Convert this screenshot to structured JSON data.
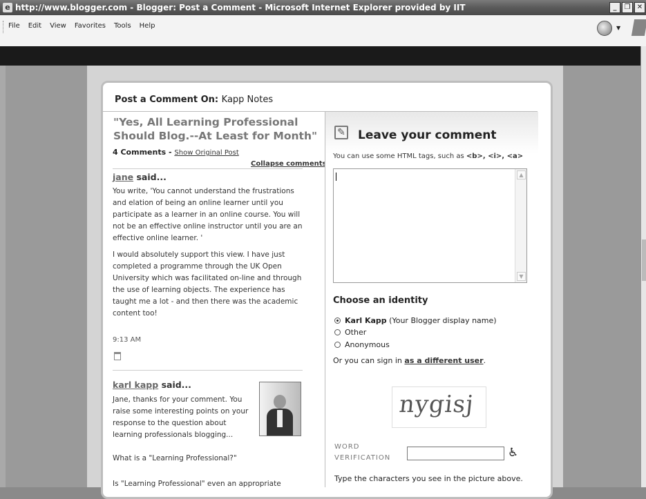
{
  "window": {
    "title": "http://www.blogger.com - Blogger: Post a Comment - Microsoft Internet Explorer provided by IIT",
    "buttons": {
      "minimize": "_",
      "restore": "❐",
      "close": "✕"
    }
  },
  "menubar": {
    "items": [
      "File",
      "Edit",
      "View",
      "Favorites",
      "Tools",
      "Help"
    ]
  },
  "page": {
    "heading_prefix": "Post a Comment On:",
    "blog_name": "Kapp Notes",
    "post_title": "\"Yes, All Learning Professional Should Blog.--At Least for Month\"",
    "comment_count": "4 Comments",
    "count_separator": "-",
    "show_original": "Show Original Post",
    "collapse": "Collapse comments",
    "comments": [
      {
        "author": "jane",
        "said": "said...",
        "text_1": "You write, 'You cannot understand the frustrations and elation of being an online learner until you participate as a learner in an online course. You will not be an effective online instructor until you are an effective online learner. '",
        "text_2": "I would absolutely support this view. I have just completed a programme through the UK Open University which was facilitated on-line and through the use of learning objects. The experience has taught me a lot - and then there was the academic content too!",
        "time": "9:13 AM"
      },
      {
        "author": "karl kapp",
        "said": "said...",
        "text_1": "Jane, thanks for your comment. You raise some interesting points on your response to the question about learning professionals blogging...",
        "text_2": "What is a \"Learning Professional?\"",
        "text_3": "Is \"Learning Professional\" even an appropriate"
      }
    ]
  },
  "form": {
    "title": "Leave your comment",
    "html_tags_prefix": "You can use some HTML tags, such as",
    "html_tags": "<b>, <i>, <a>",
    "textarea_value": "",
    "identity_heading": "Choose an identity",
    "identities": [
      {
        "name": "Karl Kapp",
        "note": "(Your Blogger display name)",
        "selected": true
      },
      {
        "name": "Other",
        "note": "",
        "selected": false
      },
      {
        "name": "Anonymous",
        "note": "",
        "selected": false
      }
    ],
    "signin_prefix": "Or you can sign in",
    "signin_link": "as a different user",
    "signin_suffix": ".",
    "captcha_text": "nygisj",
    "word_verification_line1": "WORD",
    "word_verification_line2": "VERIFICATION",
    "word_verification_value": "",
    "type_chars": "Type the characters you see in the picture above."
  }
}
